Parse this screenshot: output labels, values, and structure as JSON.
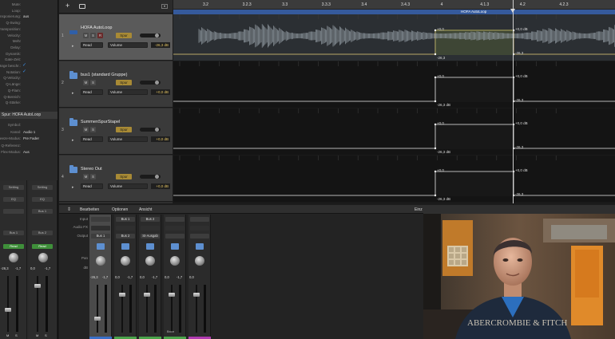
{
  "inspector": {
    "rows": [
      {
        "label": "Mute:",
        "value": ""
      },
      {
        "label": "Loop:",
        "value": ""
      },
      {
        "label": "Transponierung:",
        "value": "aus"
      },
      {
        "label": "Q-Swing:",
        "value": ""
      },
      {
        "label": "Transposition:",
        "value": ""
      },
      {
        "label": "Velocity:",
        "value": ""
      },
      {
        "label": "Mehr",
        "value": ""
      },
      {
        "label": "Delay:",
        "value": ""
      },
      {
        "label": "Dynamik:",
        "value": ""
      },
      {
        "label": "Gate-Zeit:",
        "value": ""
      },
      {
        "label": "Länge beschr.:",
        "value": "check"
      },
      {
        "label": "Notation:",
        "value": "check"
      },
      {
        "label": "Q-Velocity:",
        "value": ""
      },
      {
        "label": "Q-Länge:",
        "value": ""
      },
      {
        "label": "Q-Flam:",
        "value": ""
      },
      {
        "label": "Q-Bereich:",
        "value": ""
      },
      {
        "label": "Q-Stärke:",
        "value": ""
      }
    ],
    "track_header": "Spur: HOFA AutoLoop",
    "track_rows": [
      {
        "label": "Symbol:",
        "value": ""
      },
      {
        "label": "Kanal:",
        "value": "Audio 1"
      },
      {
        "label": "Freeze-Modus:",
        "value": "Pre Fader"
      },
      {
        "label": "Q-Referenz:",
        "value": ""
      },
      {
        "label": "Flex-Modus:",
        "value": "Aus"
      }
    ],
    "mini_strips": [
      {
        "setting": "Setting",
        "eq": "EQ",
        "input": "",
        "output": "Bus 1",
        "automation": "Read",
        "db": "-26,3",
        "pan_db": "-1,7",
        "mute": "M",
        "solo": "S"
      },
      {
        "setting": "Setting",
        "eq": "EQ",
        "input": "Bus 1",
        "output": "Bus 2",
        "automation": "Read",
        "db": "0,0",
        "pan_db": "-1,7",
        "mute": "M",
        "solo": "S"
      }
    ]
  },
  "toolbar": {
    "add_icon": "+",
    "folder_icon": "folder"
  },
  "tracks": [
    {
      "number": "1",
      "name": "HOFA AutoLoop",
      "mute": "M",
      "solo": "S",
      "record": "R",
      "spur": "Spur",
      "automation": "Read",
      "parameter": "Volume",
      "db": "-26,3 dB"
    },
    {
      "number": "2",
      "name": "bus1 (standard Gruppe)",
      "mute": "M",
      "solo": "S",
      "record": "",
      "spur": "Spur",
      "automation": "Read",
      "parameter": "Volume",
      "db": "+0,0 dB"
    },
    {
      "number": "3",
      "name": "SummenSpurStapel",
      "mute": "M",
      "solo": "S",
      "record": "",
      "spur": "Spur",
      "automation": "Read",
      "parameter": "Volume",
      "db": "+0,0 dB"
    },
    {
      "number": "4",
      "name": "Stereo Out",
      "mute": "M",
      "solo": "S",
      "record": "",
      "spur": "Spur",
      "automation": "Read",
      "parameter": "Volume",
      "db": "+0,0 dB"
    }
  ],
  "ruler": {
    "ticks": [
      "3.2",
      "3.2.3",
      "3.3",
      "3.3.3",
      "3.4",
      "3.4.3",
      "4",
      "4.1.3",
      "4.2",
      "4.2.3"
    ]
  },
  "cycle": {
    "region_label": "HOFA AutoLoop"
  },
  "lanes": [
    {
      "labels": [
        "+0,0",
        "-26,3",
        "+0,0 dB",
        "-26,3"
      ]
    },
    {
      "labels": [
        "+0,0",
        "-26,3 dB",
        "+0,0 dB",
        "-26,3"
      ]
    },
    {
      "labels": [
        "+0,0",
        "-26,3 dB",
        "+0,0 dB",
        "-26,3"
      ]
    },
    {
      "labels": [
        "+0,0",
        "-26,3 dB",
        "+0,0 dB",
        "-26,3"
      ]
    }
  ],
  "mixer": {
    "menus": [
      "Bearbeiten",
      "Optionen",
      "Ansicht"
    ],
    "right_label": "Einz",
    "side_labels": [
      "Input",
      "Audio FX",
      "Output",
      "Pan",
      "dB"
    ],
    "strips": [
      {
        "input": "",
        "output": "Bus 1",
        "db1": "-26,3",
        "db2": "-1,7",
        "selected": true,
        "color": "#3a6fc7",
        "bottom": ""
      },
      {
        "input": "Bus 1",
        "output": "Bus 2",
        "db1": "0,0",
        "db2": "-1,7",
        "selected": false,
        "color": "#4aa34a",
        "bottom": ""
      },
      {
        "input": "Bus 2",
        "output": "St-Ausgab",
        "db1": "0,0",
        "db2": "-1,7",
        "selected": false,
        "color": "#4aa34a",
        "bottom": ""
      },
      {
        "input": "",
        "output": "",
        "db1": "0,0",
        "db2": "-1,7",
        "selected": false,
        "color": "#4aa34a",
        "bottom": "Bnce"
      },
      {
        "input": "",
        "output": "",
        "db1": "0,0",
        "db2": "",
        "selected": false,
        "color": "#b03ab0",
        "bottom": ""
      }
    ]
  },
  "video": {
    "shirt_text": "ABERCROMBIE & FITCH"
  }
}
